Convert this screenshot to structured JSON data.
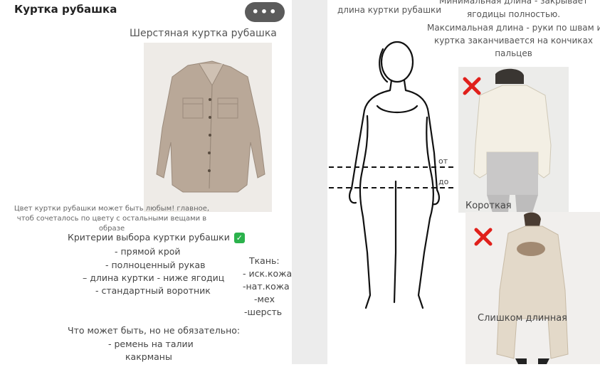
{
  "left": {
    "title": "Куртка рубашка",
    "more_button": "•••",
    "wool_jacket_title": "Шерстяная куртка рубашка",
    "color_note": "Цвет куртки рубашки может быть любым! главное, чтоб сочеталось по цвету с остальными вещами в образе",
    "criteria_title": "Критерии выбора куртки рубашки",
    "criteria": [
      "- прямой крой",
      "- полноценный рукав",
      "– длина куртки - ниже ягодиц",
      "- стандартный воротник"
    ],
    "fabric_title": "Ткань:",
    "fabrics": [
      "- иск.кожа",
      "-нат.кожа",
      "-мех",
      "-шерсть"
    ],
    "optional_title": "Что может быть, но не обязательно:",
    "optional": [
      "- ремень на талии",
      "какрманы"
    ]
  },
  "right": {
    "jacket_length_label": "длина куртки рубашки",
    "rules": [
      "Минимальная длина - закрывает",
      "ягодицы полностью.",
      "Максимальная длина - руки по швам и",
      "куртка заканчивается на кончиках",
      "пальцев"
    ],
    "from_label": "от",
    "to_label": "до",
    "short_caption": "Короткая",
    "long_caption": "Слишком длинная"
  },
  "colors": {
    "reject_mark": "#e0201b",
    "check_mark": "#2bb24c",
    "jacket": "#b9a898"
  },
  "icons": [
    "more-icon",
    "check-icon",
    "reject-x-icon"
  ]
}
